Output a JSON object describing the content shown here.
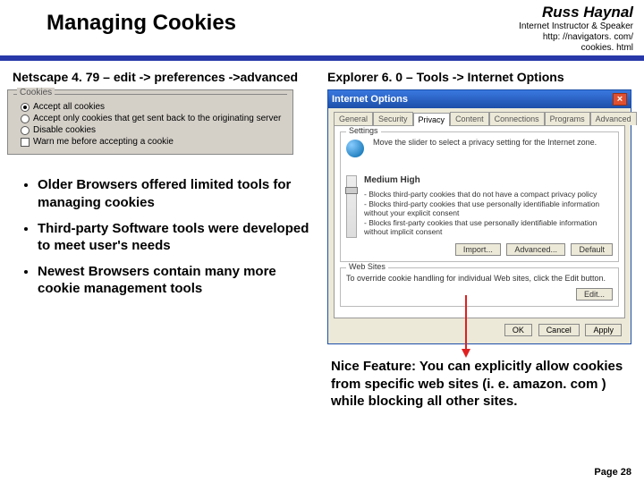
{
  "header": {
    "title": "Managing Cookies",
    "author": "Russ Haynal",
    "subtitle": "Internet Instructor & Speaker",
    "url1": "http: //navigators. com/",
    "url2": "cookies. html"
  },
  "left": {
    "heading": "Netscape 4. 79 – edit -> preferences ->advanced",
    "group_label": "Cookies",
    "opt1": "Accept all cookies",
    "opt2": "Accept only cookies that get sent back to the originating server",
    "opt3": "Disable cookies",
    "opt4": "Warn me before accepting a cookie"
  },
  "right": {
    "heading": "Explorer 6. 0 – Tools -> Internet Options",
    "window_title": "Internet Options",
    "tabs": {
      "t1": "General",
      "t2": "Security",
      "t3": "Privacy",
      "t4": "Content",
      "t5": "Connections",
      "t6": "Programs",
      "t7": "Advanced"
    },
    "settings_label": "Settings",
    "slider_intro": "Move the slider to select a privacy setting for the Internet zone.",
    "level": "Medium High",
    "b1": "- Blocks third-party cookies that do not have a compact privacy policy",
    "b2": "- Blocks third-party cookies that use personally identifiable information without your explicit consent",
    "b3": "- Blocks first-party cookies that use personally identifiable information without implicit consent",
    "btn_import": "Import...",
    "btn_advanced": "Advanced...",
    "btn_default": "Default",
    "websites_label": "Web Sites",
    "websites_text": "To override cookie handling for individual Web sites, click the Edit button.",
    "btn_edit": "Edit...",
    "btn_ok": "OK",
    "btn_cancel": "Cancel",
    "btn_apply": "Apply"
  },
  "bullets": {
    "b1": "Older Browsers offered limited tools for managing cookies",
    "b2": "Third-party Software tools were developed to meet user's needs",
    "b3": "Newest Browsers contain many more cookie management tools"
  },
  "nice": "Nice Feature: You can explicitly allow cookies from specific web sites (i. e. amazon. com ) while blocking all other sites.",
  "page": "Page 28"
}
